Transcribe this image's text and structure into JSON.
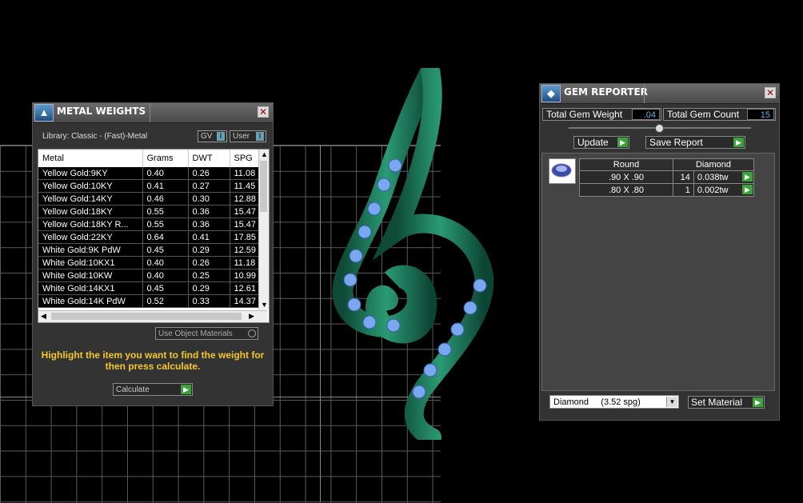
{
  "metal_panel": {
    "title": "METAL WEIGHTS",
    "library": "Library: Classic - (Fast)-Metal",
    "toggle_gv": "GV",
    "toggle_gv_state": "I",
    "toggle_user": "User",
    "toggle_user_state": "I",
    "columns": [
      "Metal",
      "Grams",
      "DWT",
      "SPG"
    ],
    "rows": [
      [
        "Yellow Gold:9KY",
        "0.40",
        "0.26",
        "11.08"
      ],
      [
        "Yellow Gold:10KY",
        "0.41",
        "0.27",
        "11.45"
      ],
      [
        "Yellow Gold:14KY",
        "0.46",
        "0.30",
        "12.88"
      ],
      [
        "Yellow Gold:18KY",
        "0.55",
        "0.36",
        "15.47"
      ],
      [
        "Yellow Gold:18KY R...",
        "0.55",
        "0.36",
        "15.47"
      ],
      [
        "Yellow Gold:22KY",
        "0.64",
        "0.41",
        "17.85"
      ],
      [
        "White Gold:9K PdW",
        "0.45",
        "0.29",
        "12.59"
      ],
      [
        "White Gold:10KX1",
        "0.40",
        "0.26",
        "11.18"
      ],
      [
        "White Gold:10KW",
        "0.40",
        "0.25",
        "10.99"
      ],
      [
        "White Gold:14KX1",
        "0.45",
        "0.29",
        "12.61"
      ],
      [
        "White Gold:14K PdW",
        "0.52",
        "0.33",
        "14.37"
      ]
    ],
    "use_object_materials": "Use Object Materials",
    "hint": "Highlight the item you want to find the weight for then press calculate.",
    "calculate": "Calculate"
  },
  "gem_panel": {
    "title": "GEM REPORTER",
    "total_weight_label": "Total Gem Weight",
    "total_weight_value": ".04",
    "total_count_label": "Total Gem Count",
    "total_count_value": "15",
    "update": "Update",
    "save_report": "Save Report",
    "table_headers": [
      "Round",
      "Diamond"
    ],
    "gems": [
      {
        "size": ".90 X .90",
        "count": "14",
        "weight": "0.038tw"
      },
      {
        "size": ".80 X .80",
        "count": "1",
        "weight": "0.002tw"
      }
    ],
    "material": "Diamond     (3.52 spg)",
    "set_material": "Set Material"
  },
  "colors": {
    "accent_green": "#3aa43a",
    "hint_yellow": "#f3c82a",
    "jewel_green": "#1f7a5c",
    "gem_blue": "#7aa8f0"
  }
}
